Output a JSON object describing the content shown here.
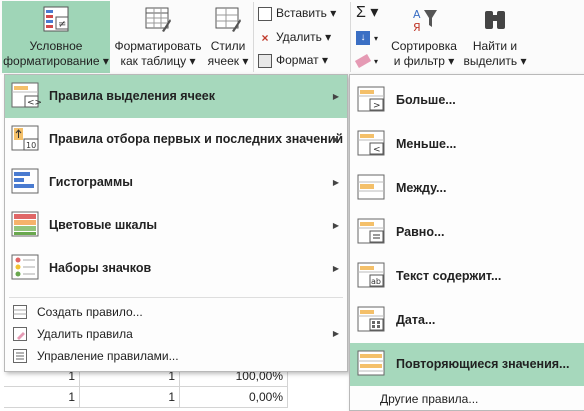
{
  "ribbon": {
    "cond_format": {
      "line1": "Условное",
      "line2": "форматирование ▾"
    },
    "format_table": {
      "line1": "Форматировать",
      "line2": "как таблицу ▾"
    },
    "styles": {
      "line1": "Стили",
      "line2": "ячеек ▾"
    },
    "insert": "Вставить ▾",
    "delete": "Удалить ▾",
    "format": "Формат ▾",
    "sigma": "Σ ▾",
    "sort": {
      "line1": "Сортировка",
      "line2": "и фильтр ▾"
    },
    "find": {
      "line1": "Найти и",
      "line2": "выделить ▾"
    }
  },
  "menu": {
    "items": [
      {
        "label": "Правила выделения ячеек",
        "icon": "highlight-cells-rules-icon"
      },
      {
        "label": "Правила отбора первых и последних значений",
        "icon": "top-bottom-rules-icon"
      },
      {
        "label": "Гистограммы",
        "icon": "data-bars-icon"
      },
      {
        "label": "Цветовые шкалы",
        "icon": "color-scales-icon"
      },
      {
        "label": "Наборы значков",
        "icon": "icon-sets-icon"
      }
    ],
    "actions": [
      {
        "label": "Создать правило...",
        "icon": "new-rule-icon"
      },
      {
        "label": "Удалить правила",
        "icon": "clear-rules-icon"
      },
      {
        "label": "Управление правилами...",
        "icon": "manage-rules-icon"
      }
    ]
  },
  "submenu": {
    "items": [
      {
        "label": "Больше...",
        "icon": "greater-than-icon"
      },
      {
        "label": "Меньше...",
        "icon": "less-than-icon"
      },
      {
        "label": "Между...",
        "icon": "between-icon"
      },
      {
        "label": "Равно...",
        "icon": "equal-to-icon"
      },
      {
        "label": "Текст содержит...",
        "icon": "text-contains-icon"
      },
      {
        "label": "Дата...",
        "icon": "date-occurring-icon"
      },
      {
        "label": "Повторяющиеся значения...",
        "icon": "duplicate-values-icon"
      }
    ],
    "other": "Другие правила..."
  },
  "grid": {
    "rows": [
      {
        "a": "1",
        "b": "1",
        "c": "100,00%"
      },
      {
        "a": "1",
        "b": "1",
        "c": "0,00%"
      }
    ]
  },
  "colors": {
    "highlight": "#a6d8bc",
    "accent": "#217346"
  }
}
